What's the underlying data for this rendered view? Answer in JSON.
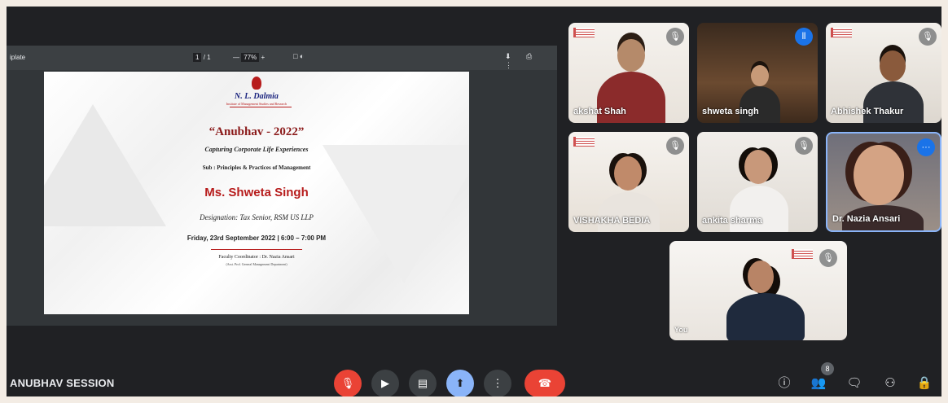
{
  "presentation": {
    "doc_name": "iplate",
    "page_current": "1",
    "page_total": "1",
    "zoom": "77%",
    "toolbar_left_icons": "□ ◐",
    "toolbar_right_icons": "⬇ ⎙ ⋮",
    "slide": {
      "institute": "N. L. Dalmia",
      "institute_sub": "Institute of Management Studies and Research",
      "title": "“Anubhav - 2022”",
      "tagline": "Capturing Corporate Life Experiences",
      "subject": "Sub : Principles & Practices of Management",
      "speaker": "Ms. Shweta Singh",
      "designation": "Designation: Tax Senior, RSM US LLP",
      "date_time": "Friday, 23rd September 2022 | 6:00 – 7:00 PM",
      "coordinator": "Faculty Coordinator : Dr. Nazia Ansari",
      "coordinator_sub": "(Asst. Prof. General Management Department)"
    }
  },
  "participants": [
    {
      "name": "akshat Shah",
      "mic": "muted"
    },
    {
      "name": "shweta singh",
      "mic": "speaking"
    },
    {
      "name": "Abhishek Thakur",
      "mic": "muted"
    },
    {
      "name": "VISHAKHA BEDIA",
      "mic": "muted"
    },
    {
      "name": "ankita sharma",
      "mic": "muted"
    },
    {
      "name": "Dr. Nazia Ansari",
      "mic": "more"
    },
    {
      "name": "You",
      "mic": "muted"
    }
  ],
  "icons": {
    "mic_off": "🎙",
    "speaking": "⦀",
    "more": "···"
  },
  "bottom_bar": {
    "meeting_name": "ANUBHAV SESSION",
    "participant_count": "8",
    "controls": {
      "mic": "🎙",
      "camera": "▶",
      "captions": "▤",
      "present": "⬆",
      "more": "⋮",
      "end_call": "☎"
    },
    "right": {
      "info": "ⓘ",
      "people": "👥",
      "chat": "🗨",
      "activities": "⚇",
      "host": "🔒"
    }
  },
  "colors": {
    "background": "#202124",
    "end_call": "#ea4335",
    "present_active": "#8ab4f8",
    "speaking": "#1a73e8"
  }
}
